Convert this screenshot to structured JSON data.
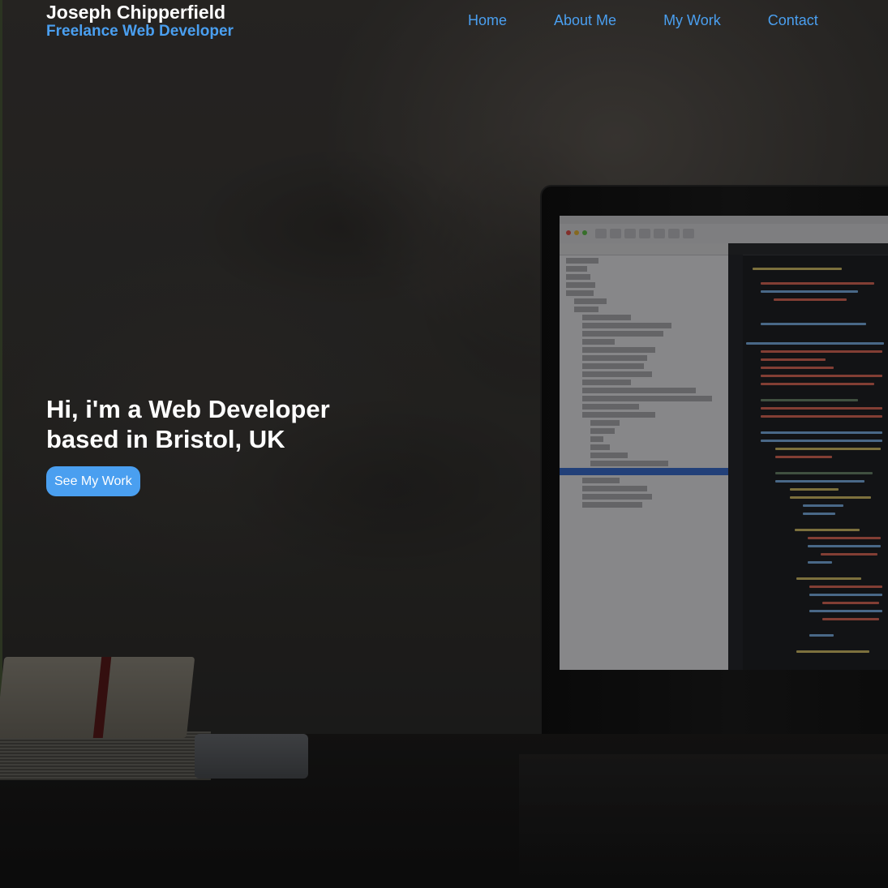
{
  "header": {
    "name": "Joseph Chipperfield",
    "tagline": "Freelance Web Developer"
  },
  "nav": {
    "items": [
      {
        "label": "Home"
      },
      {
        "label": "About Me"
      },
      {
        "label": "My Work"
      },
      {
        "label": "Contact"
      }
    ]
  },
  "hero": {
    "heading_line1": "Hi, i'm a Web Developer",
    "heading_line2": "based in Bristol, UK",
    "cta_label": "See My Work"
  },
  "colors": {
    "accent": "#4a9ff0",
    "heading_text": "#ffffff",
    "overlay": "rgba(0,0,0,0.42)"
  }
}
